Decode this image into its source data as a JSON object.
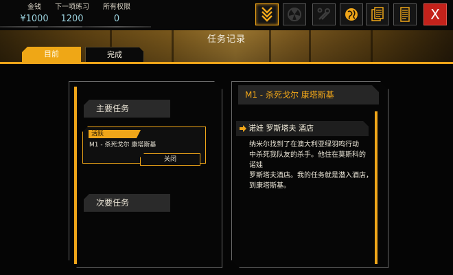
{
  "hud": {
    "money_label": "金钱",
    "money_value": "¥1000",
    "next_practice_label": "下一项练习",
    "next_practice_value": "1200",
    "permissions_label": "所有权限",
    "permissions_value": "0"
  },
  "toolbar": {
    "buttons": [
      "augmentation-icon",
      "radiation-icon",
      "tools-icon",
      "globe-icon",
      "documents-icon",
      "notes-icon"
    ],
    "close_label": "X"
  },
  "page": {
    "title": "任务记录",
    "tabs": [
      {
        "label": "目前",
        "active": true
      },
      {
        "label": "完成",
        "active": false
      }
    ]
  },
  "left_panel": {
    "main_missions_label": "主要任务",
    "active_tag": "活跃",
    "mission_name": "M1 - 杀死戈尔 康塔斯基",
    "close_button": "关闭",
    "side_missions_label": "次要任务"
  },
  "right_panel": {
    "header": "M1 - 杀死戈尔 康塔斯基",
    "objective": "诺娃 罗斯塔夫 酒店",
    "description_lines": [
      "纳米尔找到了在澳大利亚绿羽鸣行动",
      "中杀死我队友的杀手。他住在莫斯科的",
      "诺娃",
      "罗斯塔夫酒店。我的任务就是潜入酒店，",
      "到康塔斯基。"
    ]
  },
  "colors": {
    "accent": "#f0a619",
    "value_text": "#9ad0dc",
    "close_red": "#c4221b"
  }
}
